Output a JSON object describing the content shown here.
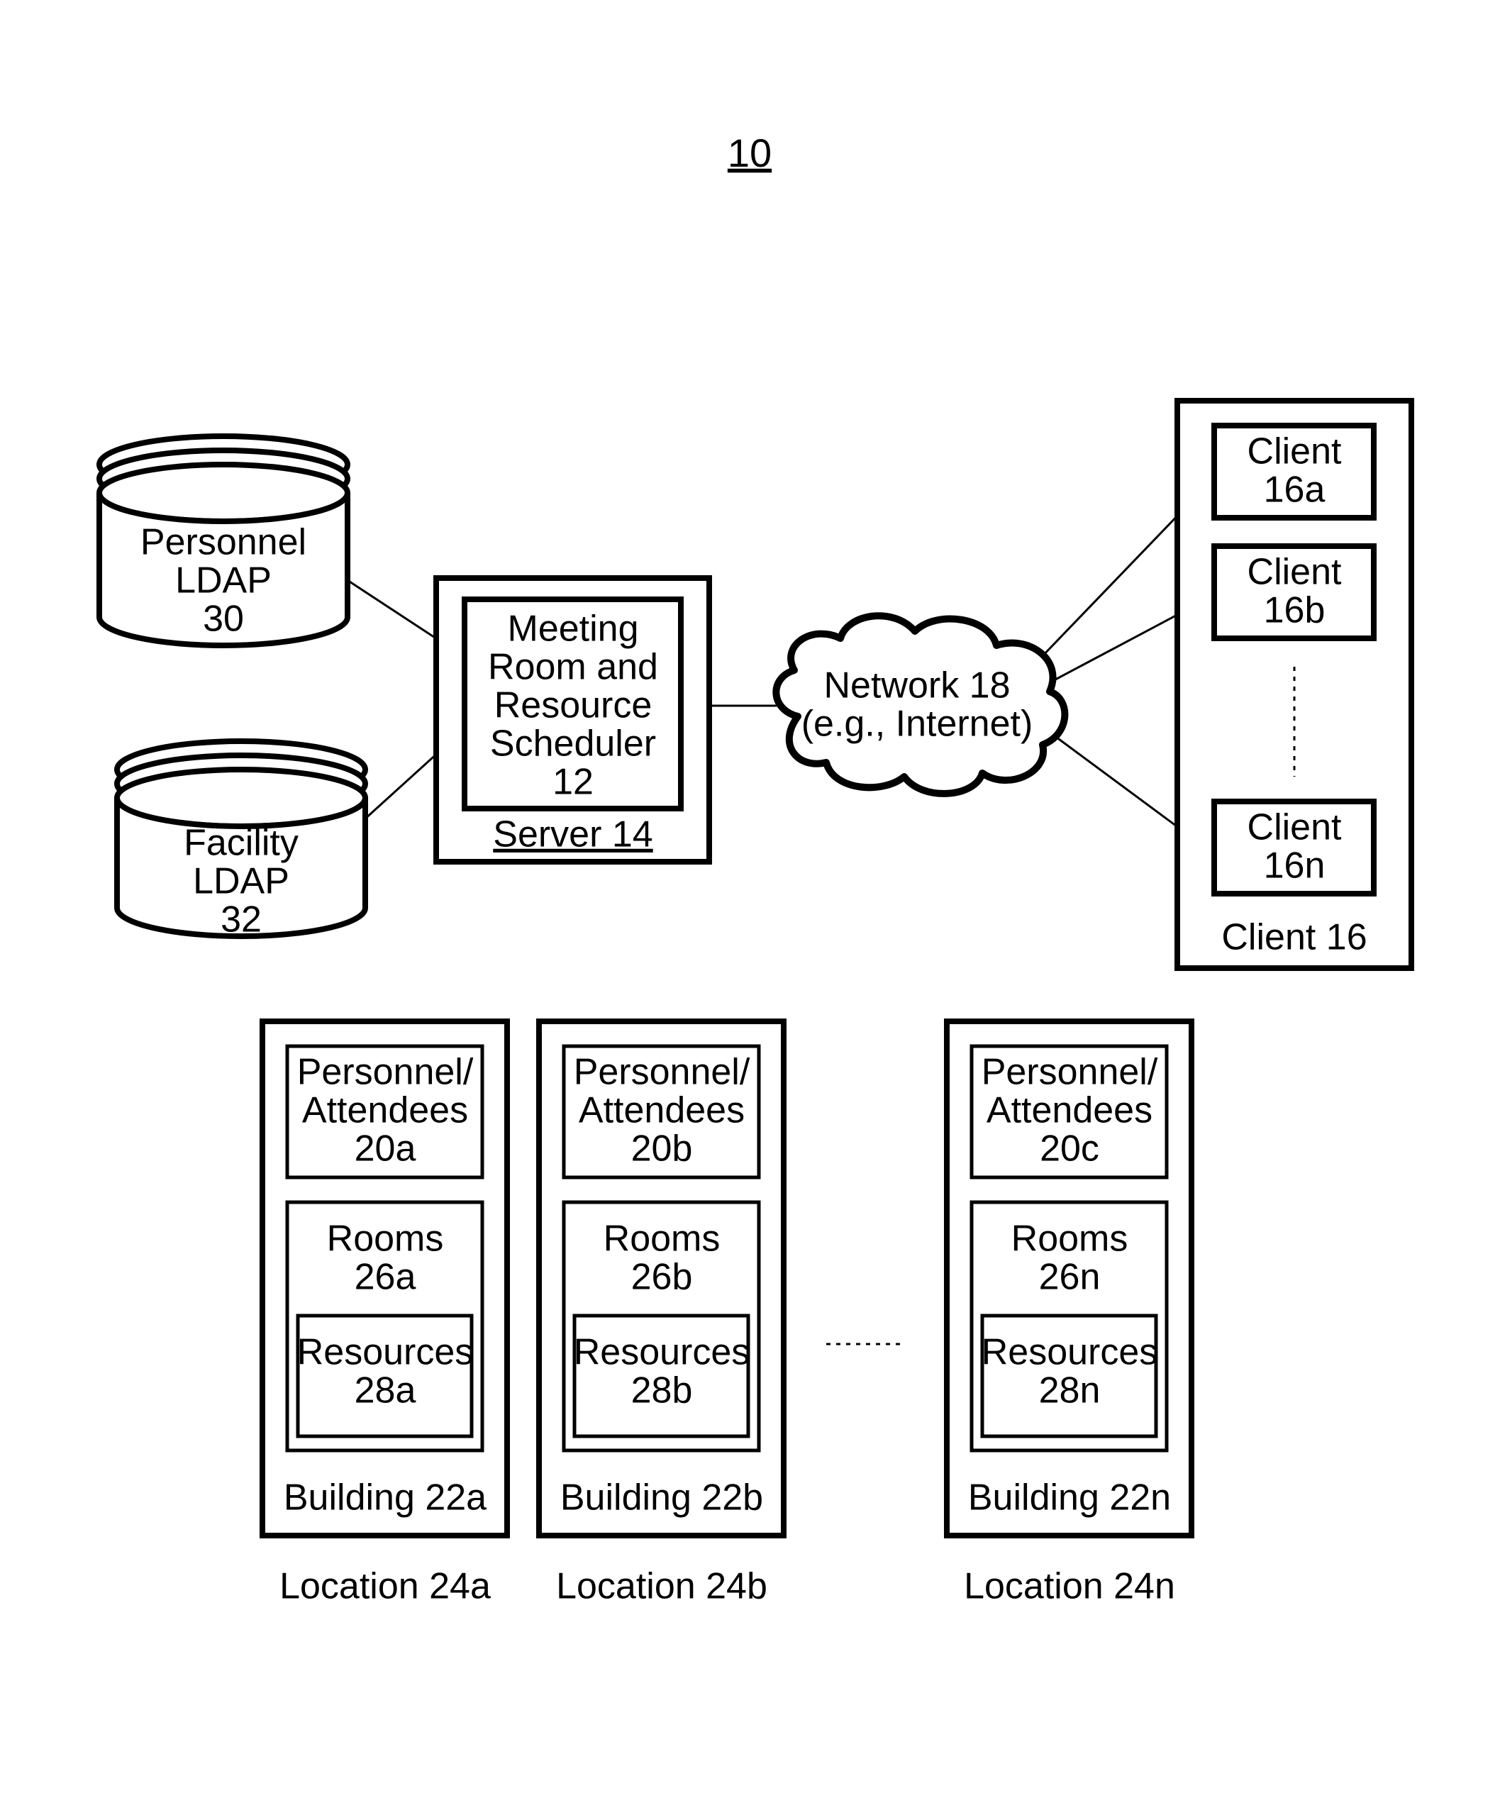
{
  "figure": {
    "title": "10"
  },
  "db1": {
    "line1": "Personnel",
    "line2": "LDAP",
    "num": "30"
  },
  "db2": {
    "line1": "Facility",
    "line2": "LDAP",
    "num": "32"
  },
  "server": {
    "inner": {
      "l1": "Meeting",
      "l2": "Room and",
      "l3": "Resource",
      "l4": "Scheduler",
      "num": "12"
    },
    "caption": "Server 14"
  },
  "network": {
    "l1": "Network 18",
    "l2": "(e.g., Internet)"
  },
  "clientbox": {
    "c1": {
      "l1": "Client",
      "l2": "16a"
    },
    "c2": {
      "l1": "Client",
      "l2": "16b"
    },
    "cn": {
      "l1": "Client",
      "l2": "16n"
    },
    "caption": "Client 16"
  },
  "buildings": {
    "a": {
      "pa": {
        "l1": "Personnel/",
        "l2": "Attendees",
        "num": "20a"
      },
      "rooms": {
        "l1": "Rooms",
        "num": "26a"
      },
      "res": {
        "l1": "Resources",
        "num": "28a"
      },
      "cap": "Building 22a",
      "loc": "Location 24a"
    },
    "b": {
      "pa": {
        "l1": "Personnel/",
        "l2": "Attendees",
        "num": "20b"
      },
      "rooms": {
        "l1": "Rooms",
        "num": "26b"
      },
      "res": {
        "l1": "Resources",
        "num": "28b"
      },
      "cap": "Building 22b",
      "loc": "Location 24b"
    },
    "n": {
      "pa": {
        "l1": "Personnel/",
        "l2": "Attendees",
        "num": "20c"
      },
      "rooms": {
        "l1": "Rooms",
        "num": "26n"
      },
      "res": {
        "l1": "Resources",
        "num": "28n"
      },
      "cap": "Building 22n",
      "loc": "Location 24n"
    }
  }
}
